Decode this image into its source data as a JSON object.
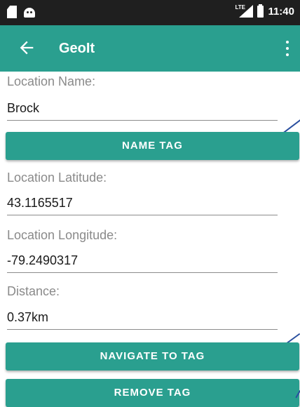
{
  "status_bar": {
    "time": "11:40",
    "network": "LTE"
  },
  "app_bar": {
    "title": "GeoIt"
  },
  "form": {
    "name_label": "Location Name:",
    "name_value": "Brock",
    "name_tag_button": "NAME TAG",
    "latitude_label": "Location Latitude:",
    "latitude_value": "43.1165517",
    "longitude_label": "Location Longitude:",
    "longitude_value": "-79.2490317",
    "distance_label": "Distance:",
    "distance_value": "0.37km",
    "navigate_button": "NAVIGATE TO TAG",
    "remove_button": "REMOVE TAG"
  },
  "colors": {
    "primary": "#2a9f8f",
    "status_bar": "#1f1f1f"
  },
  "icons": {
    "back": "arrow-left-icon",
    "menu": "more-vert-icon"
  }
}
